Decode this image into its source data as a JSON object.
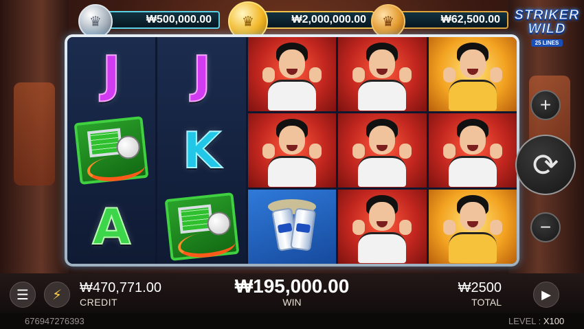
{
  "jackpots": [
    {
      "tier": "silver",
      "amount": "₩500,000.00"
    },
    {
      "tier": "gold",
      "amount": "₩2,000,000.00"
    },
    {
      "tier": "bronze",
      "amount": "₩62,500.00"
    }
  ],
  "logo": {
    "line1": "STRIKER",
    "line2": "WILD",
    "lines": "25 LINES"
  },
  "reels": [
    [
      "J",
      "wild-goal",
      "A"
    ],
    [
      "J",
      "K",
      "wild-goal"
    ],
    [
      "player",
      "player",
      "cans"
    ],
    [
      "player",
      "player",
      "player"
    ],
    [
      "player-gold",
      "player",
      "player-gold"
    ]
  ],
  "letters": {
    "r1c1": "J",
    "r1c3": "A",
    "r2c1": "J",
    "r2c2": "K"
  },
  "controls": {
    "plus_icon": "+",
    "spin_icon": "⟳",
    "minus_icon": "−",
    "menu_icon": "☰",
    "turbo_icon": "⚡",
    "autoplay_icon": "▶"
  },
  "balance": {
    "credit_value": "₩470,771.00",
    "credit_label": "CREDIT",
    "win_value": "₩195,000.00",
    "win_label": "WIN",
    "total_value": "₩2500",
    "total_label": "TOTAL"
  },
  "footer": {
    "session_id": "676947276393",
    "level_label": "LEVEL :",
    "level_value": "X100"
  },
  "colors": {
    "accent_cyan": "#5ad2e6",
    "gold": "#f3c54a",
    "red_cell": "#c3271f"
  }
}
